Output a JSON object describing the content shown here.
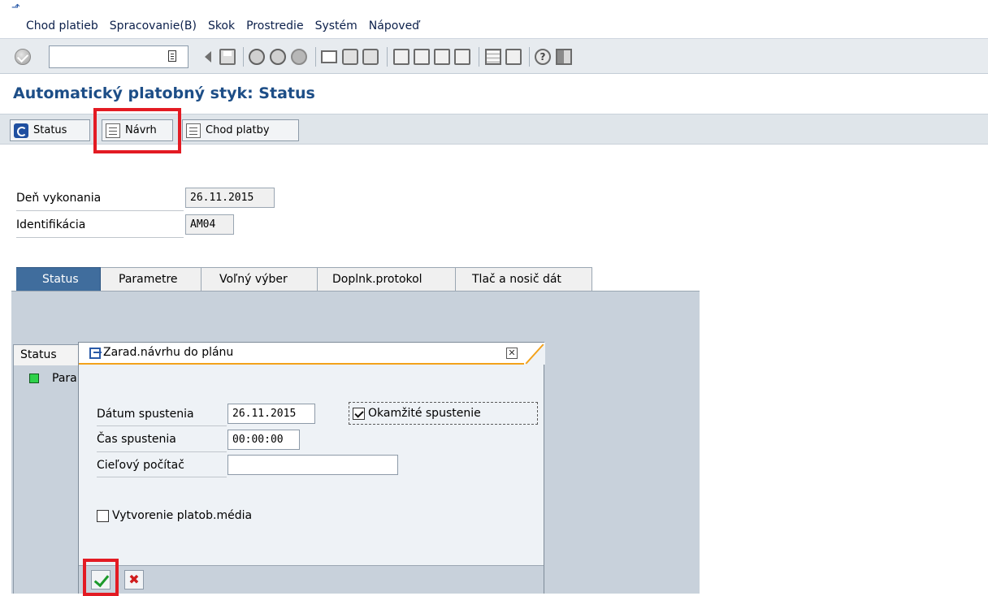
{
  "menu": {
    "items": [
      "Chod platieb",
      "Spracovanie(B)",
      "Skok",
      "Prostredie",
      "Systém",
      "Nápoveď"
    ]
  },
  "toolbar": {
    "command_field_value": "",
    "icons": [
      "enter-icon",
      "back-icon",
      "save-icon",
      "back-nav-icon",
      "exit-icon",
      "cancel-icon",
      "print-icon",
      "find-icon",
      "find-next-icon",
      "first-page-icon",
      "prev-page-icon",
      "next-page-icon",
      "last-page-icon",
      "new-session-icon",
      "shortcut-icon",
      "help-icon",
      "layout-icon"
    ]
  },
  "page": {
    "title": "Automatický platobný styk: Status"
  },
  "app_toolbar": {
    "status_label": "Status",
    "proposal_label": "Návrh",
    "payment_run_label": "Chod platby"
  },
  "fields": {
    "run_date_label": "Deň vykonania",
    "run_date_value": "26.11.2015",
    "identification_label": "Identifikácia",
    "identification_value": "AM04"
  },
  "tabs": [
    "Status",
    "Parametre",
    "Voľný výber",
    "Doplnk.protokol",
    "Tlač a nosič dát"
  ],
  "inner": {
    "status_tab_label": "Status",
    "status_line_text": "Para"
  },
  "dialog": {
    "title": "Zarad.návrhu do plánu",
    "start_date_label": "Dátum spustenia",
    "start_date_value": "26.11.2015",
    "start_time_label": "Čas spustenia",
    "start_time_value": "00:00:00",
    "target_host_label": "Cieľový počítač",
    "target_host_value": "",
    "immediate_start_label": "Okamžité spustenie",
    "immediate_start_checked": true,
    "create_media_label": "Vytvorenie platob.média",
    "create_media_checked": false
  },
  "colors": {
    "title_blue": "#1d4e87",
    "tab_active": "#406d9d",
    "highlight_red": "#e31b23",
    "dialog_accent": "#f3a21b"
  }
}
